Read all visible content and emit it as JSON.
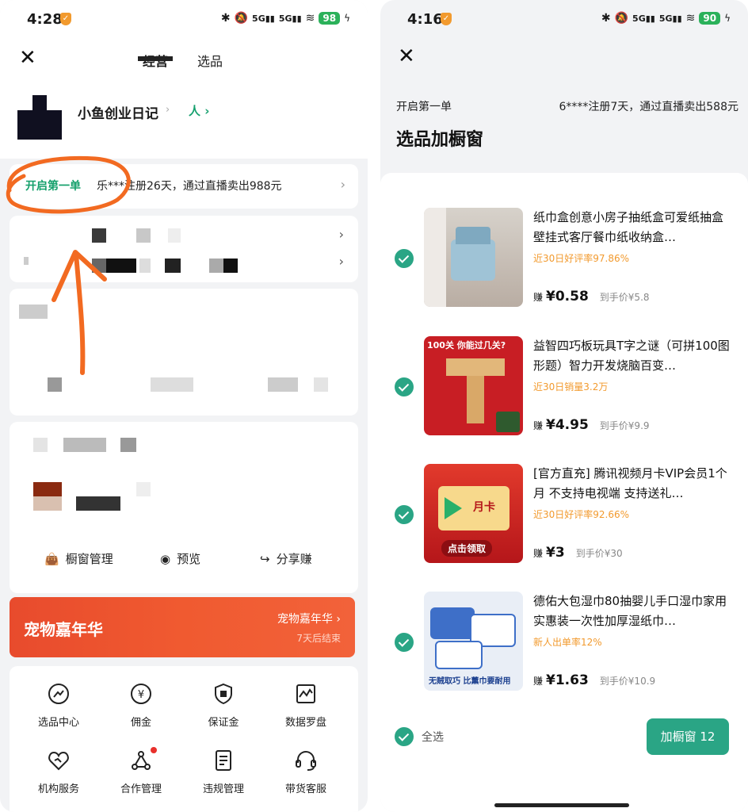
{
  "left": {
    "status": {
      "time": "4:28",
      "battery": "98"
    },
    "header": {
      "tab_active": "经营",
      "tab_inactive": "选品"
    },
    "profile": {
      "name": "小鱼创业日记",
      "link": "人"
    },
    "first_order": {
      "title": "开启第一单",
      "text": "乐***注册26天，通过直播卖出988元"
    },
    "actions": {
      "window_manage": "橱窗管理",
      "preview": "预览",
      "share_earn": "分享赚"
    },
    "banner": {
      "title": "宠物嘉年华",
      "right_label": "宠物嘉年华",
      "sub": "7天后结束"
    },
    "grid": [
      {
        "label": "选品中心",
        "icon": "selection-center-icon"
      },
      {
        "label": "佣金",
        "icon": "yen-coin-icon"
      },
      {
        "label": "保证金",
        "icon": "deposit-shield-icon"
      },
      {
        "label": "数据罗盘",
        "icon": "data-chart-icon"
      },
      {
        "label": "机构服务",
        "icon": "heart-handshake-icon"
      },
      {
        "label": "合作管理",
        "icon": "network-nodes-icon"
      },
      {
        "label": "违规管理",
        "icon": "document-list-icon"
      },
      {
        "label": "带货客服",
        "icon": "headset-icon"
      }
    ]
  },
  "right": {
    "status": {
      "time": "4:16",
      "battery": "90"
    },
    "header": {
      "label": "开启第一单",
      "info": "6****注册7天，通过直播卖出588元",
      "title": "选品加橱窗"
    },
    "products": [
      {
        "title": "纸巾盒创意小房子抽纸盒可爱纸抽盒壁挂式客厅餐巾纸收纳盒…",
        "rate": "近30日好评率97.86%",
        "earn_label": "赚",
        "earn": "¥0.58",
        "net": "到手价¥5.8"
      },
      {
        "title": "益智四巧板玩具T字之谜（可拼100图形题）智力开发烧脑百变…",
        "rate": "近30日销量3.2万",
        "earn_label": "赚",
        "earn": "¥4.95",
        "net": "到手价¥9.9"
      },
      {
        "title": "[官方直充] 腾讯视频月卡VIP会员1个月 不支持电视端 支持送礼…",
        "rate": "近30日好评率92.66%",
        "earn_label": "赚",
        "earn": "¥3",
        "net": "到手价¥30"
      },
      {
        "title": "德佑大包湿巾80抽婴儿手口湿巾家用实惠装一次性加厚湿纸巾…",
        "rate": "新人出单率12%",
        "earn_label": "赚",
        "earn": "¥1.63",
        "net": "到手价¥10.9"
      }
    ],
    "thumb_text": {
      "p2_banner": "100关 你能过几关?",
      "p3_card": "月卡",
      "p3_bottom": "点击领取",
      "p4_bottom": "无贼取巧 比薰巾要耐用"
    },
    "footer": {
      "select_all": "全选",
      "button": "加橱窗 12"
    }
  }
}
